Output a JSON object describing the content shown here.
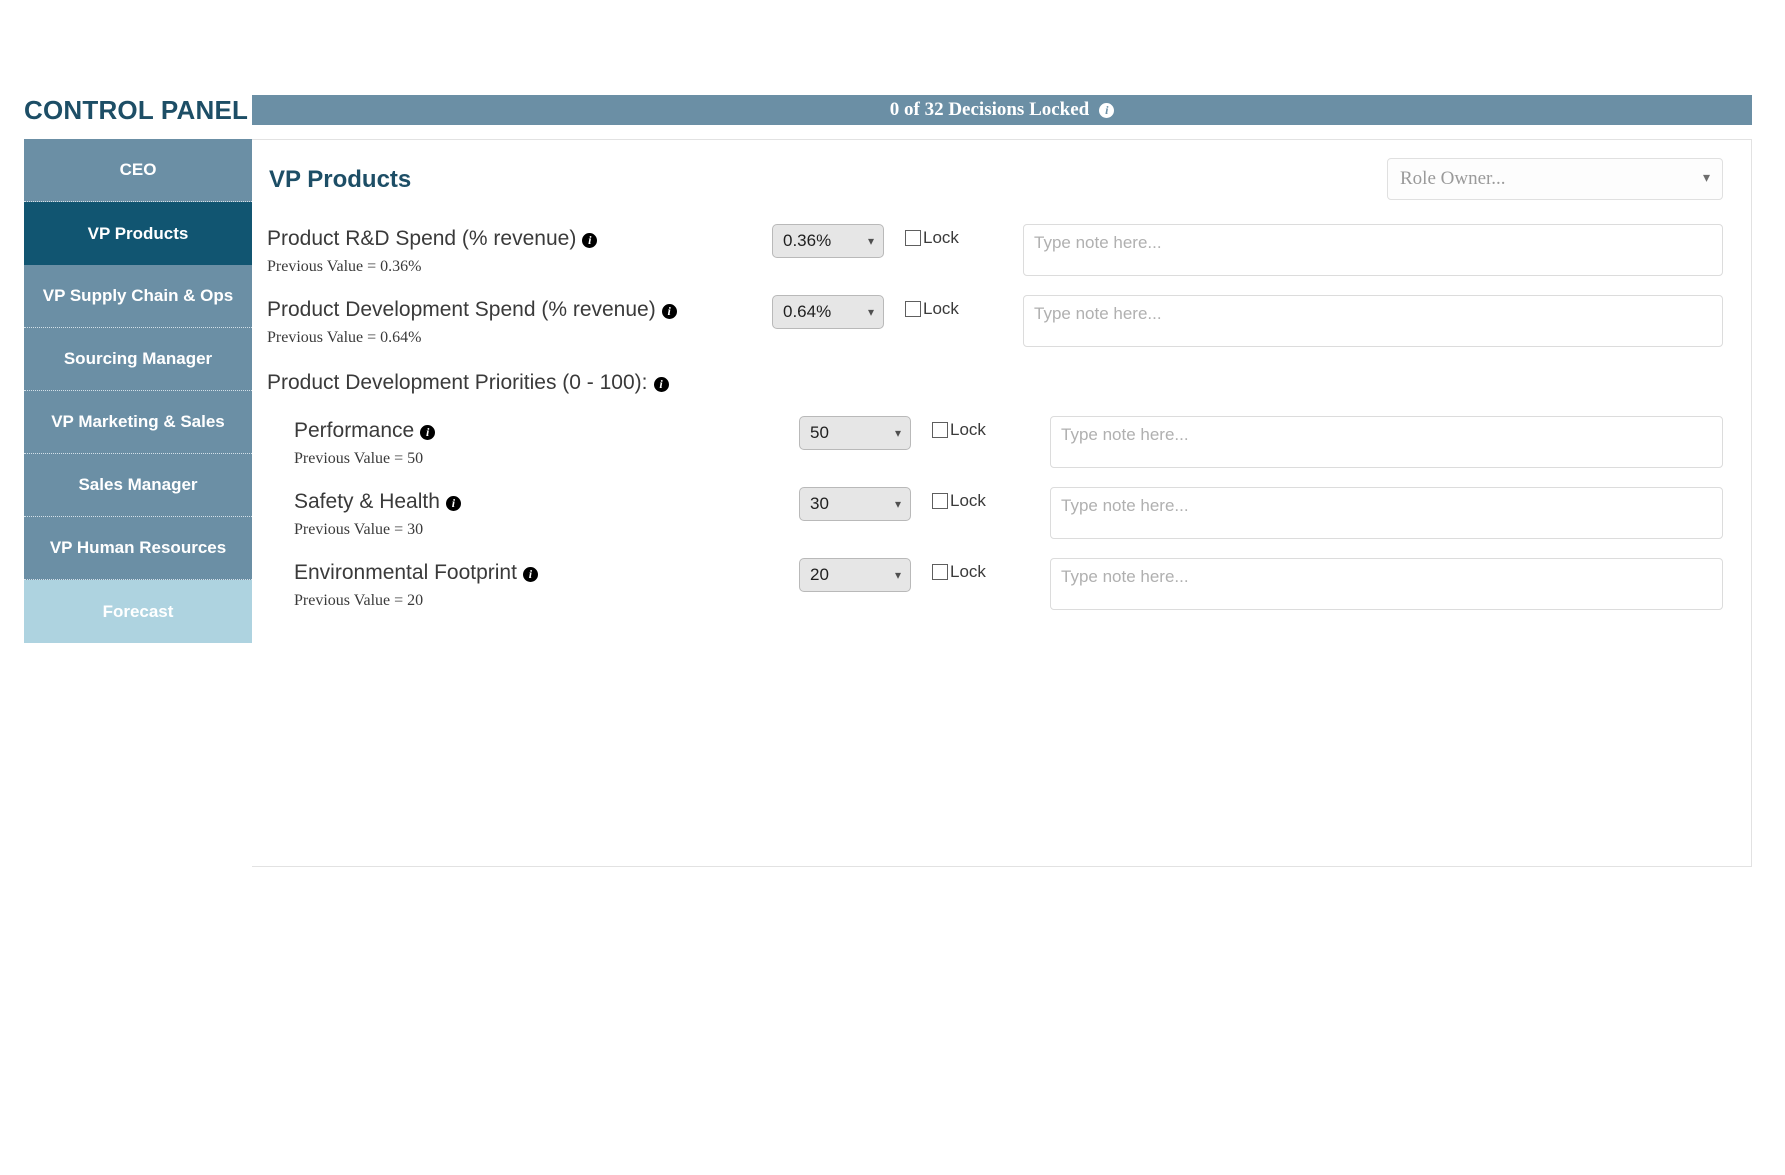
{
  "header": {
    "app_title": "CONTROL PANEL",
    "lock_status": "0 of 32 Decisions Locked",
    "lock_info_icon": "info-icon"
  },
  "sidebar": {
    "items": [
      {
        "label": "CEO",
        "state": "default"
      },
      {
        "label": "VP Products",
        "state": "active"
      },
      {
        "label": "VP Supply Chain & Ops",
        "state": "default"
      },
      {
        "label": "Sourcing Manager",
        "state": "default"
      },
      {
        "label": "VP Marketing & Sales",
        "state": "default"
      },
      {
        "label": "Sales Manager",
        "state": "default"
      },
      {
        "label": "VP Human Resources",
        "state": "default"
      },
      {
        "label": "Forecast",
        "state": "highlight"
      }
    ]
  },
  "panel": {
    "title": "VP Products",
    "role_owner": {
      "selected": "Role Owner...",
      "chevron": "chevron-down-icon"
    },
    "section_heading": {
      "label": "Product Development Priorities (0 - 100):",
      "info_icon": "info-icon"
    },
    "lock_label": "Lock",
    "note_placeholder": "Type note here...",
    "chevron": "chevron-down-icon",
    "decisions": [
      {
        "label": "Product R&D Spend (% revenue)",
        "info_icon": "info-icon",
        "value": "0.36%",
        "previous": "Previous Value = 0.36%",
        "locked": false,
        "note": "",
        "indented": false
      },
      {
        "label": "Product Development Spend (% revenue)",
        "info_icon": "info-icon",
        "value": "0.64%",
        "previous": "Previous Value = 0.64%",
        "locked": false,
        "note": "",
        "indented": false
      },
      {
        "label": "Performance",
        "info_icon": "info-icon",
        "value": "50",
        "previous": "Previous Value = 50",
        "locked": false,
        "note": "",
        "indented": true
      },
      {
        "label": "Safety & Health",
        "info_icon": "info-icon",
        "value": "30",
        "previous": "Previous Value = 30",
        "locked": false,
        "note": "",
        "indented": true
      },
      {
        "label": "Environmental Footprint",
        "info_icon": "info-icon",
        "value": "20",
        "previous": "Previous Value = 20",
        "locked": false,
        "note": "",
        "indented": true
      }
    ]
  },
  "colors": {
    "brand_dark": "#1d4e66",
    "sidebar_blue": "#6b8fa5",
    "active_blue": "#115571",
    "forecast_blue": "#aed3e0"
  }
}
